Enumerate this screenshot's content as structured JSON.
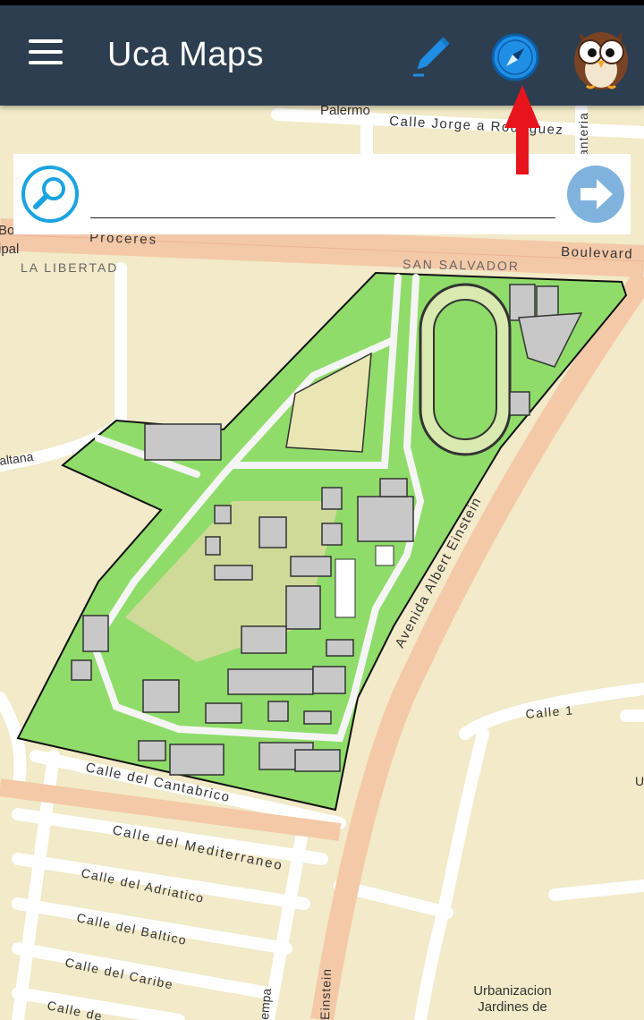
{
  "app": {
    "title": "Uca Maps"
  },
  "toolbar": {
    "menu_icon": "hamburger-menu-icon",
    "edit_icon": "pencil-icon",
    "compass_icon": "compass-icon",
    "profile_icon": "owl-avatar-icon"
  },
  "search": {
    "placeholder": "",
    "value": "",
    "search_icon": "magnifier-icon",
    "go_icon": "arrow-right-circle-icon"
  },
  "annotation": {
    "arrow_icon": "red-arrow-up-icon"
  },
  "map": {
    "labels": {
      "palermo": "Palermo",
      "jorge": "Calle Jorge a Rodriguez",
      "proceres": "Próceres",
      "bo": "Bo",
      "ipal": "ipal",
      "libertad": "LA LIBERTAD",
      "salvador": "SAN SALVADOR",
      "boulevard": "Boulevard",
      "manteria": "anteria",
      "altana": "altana",
      "einstein": "Avenida Albert Einstein",
      "calle1": "Calle 1",
      "cantabrico": "Calle del Cantabrico",
      "mediterraneo": "Calle del Mediterraneo",
      "adriatico": "Calle del Adriatico",
      "baltico": "Calle del Baltico",
      "caribe": "Calle del Caribe",
      "calle_cut": "Calle de",
      "einstein2": "Einstein",
      "empa": "empa",
      "urb1": "Urbanizacion",
      "urb2": "Jardines de",
      "u": "U"
    },
    "colors": {
      "land": "#f2eac8",
      "campus_green": "#8fdc6a",
      "road_major": "#f4c9a8",
      "building": "#c8c8c8"
    }
  },
  "colors": {
    "appbar": "#2c3e50",
    "accent_blue": "#1f8fe6",
    "search_icon": "#1aa3e0",
    "go_button": "#7fb3dd",
    "arrow_red": "#e8141c"
  }
}
